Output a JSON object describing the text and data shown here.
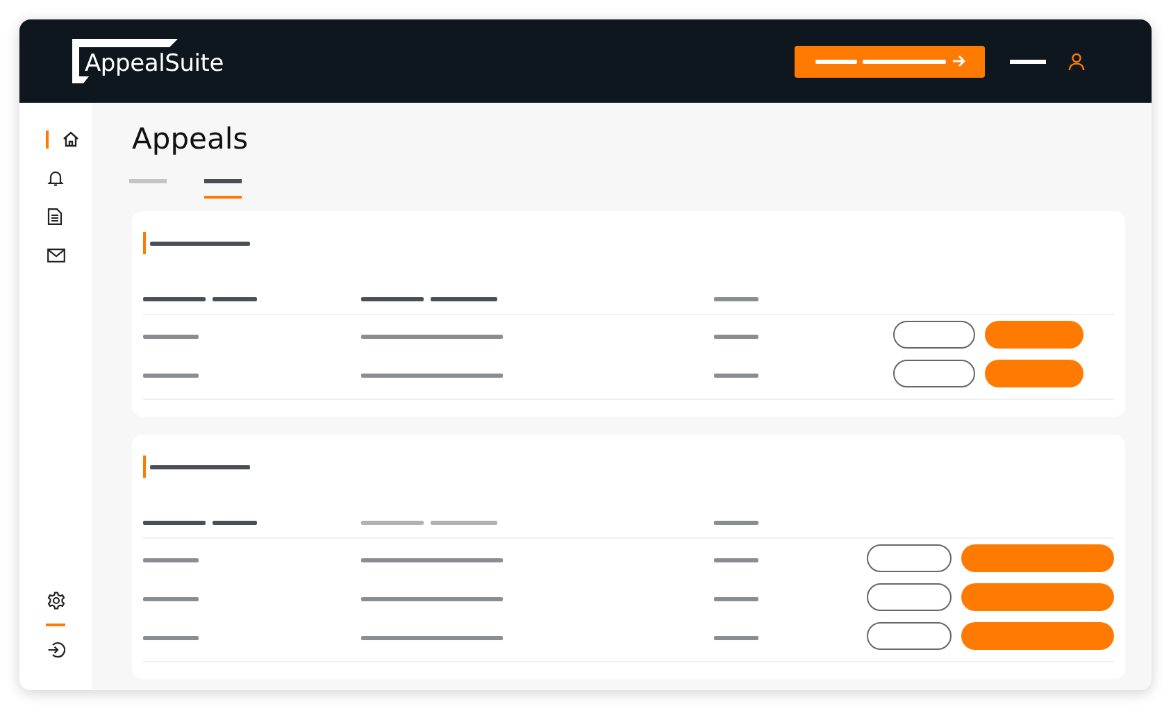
{
  "header": {
    "logo": "AppealSuite"
  },
  "nav": [
    {
      "kind": "home",
      "selected": true
    },
    {
      "kind": "bell",
      "selected": false
    },
    {
      "kind": "document",
      "selected": false
    },
    {
      "kind": "mail",
      "selected": false
    }
  ],
  "nav_bottom": [
    {
      "kind": "settings"
    },
    {
      "kind": "divider"
    },
    {
      "kind": "logout"
    }
  ],
  "page": {
    "title": "Appeals"
  },
  "tabs": [
    {
      "selected": false
    },
    {
      "selected": true
    }
  ],
  "cards": [
    {
      "kind": "compact",
      "header_columns": [
        {
          "muted": false
        },
        {
          "muted": false
        },
        {
          "muted": false
        }
      ],
      "rows": [
        {
          "kind": "skeleton"
        },
        {
          "kind": "skeleton"
        }
      ]
    },
    {
      "kind": "wide",
      "header_columns": [
        {
          "muted": false
        },
        {
          "muted": true
        },
        {
          "muted": false
        }
      ],
      "rows": [
        {
          "kind": "skeleton"
        },
        {
          "kind": "skeleton"
        },
        {
          "kind": "skeleton"
        }
      ]
    }
  ]
}
